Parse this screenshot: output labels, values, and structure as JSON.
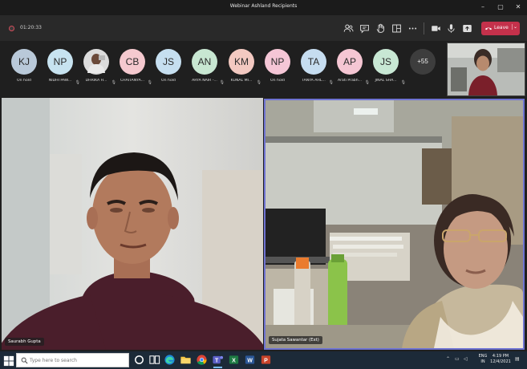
{
  "window": {
    "title": "Webinar Ashland Recipients"
  },
  "toolbar": {
    "timer": "01:20:33",
    "leave_label": "Leave",
    "accent": "#c4314b"
  },
  "participants": [
    {
      "initials": "KJ",
      "name": "On hold",
      "color": "#b9c9d9",
      "muted": false
    },
    {
      "initials": "NP",
      "name": "NIDHI PAW...",
      "color": "#c7e3f0",
      "muted": true
    },
    {
      "initials": "",
      "name": "DHRIKA H...",
      "color": "#e6e6e6",
      "muted": true,
      "photo": true
    },
    {
      "initials": "CB",
      "name": "CHAITANYA...",
      "color": "#f5c9cf",
      "muted": true
    },
    {
      "initials": "JS",
      "name": "On hold",
      "color": "#c6dff0",
      "muted": false
    },
    {
      "initials": "AN",
      "name": "ARYA NAIR -...",
      "color": "#c8e7d2",
      "muted": true
    },
    {
      "initials": "KM",
      "name": "KUNAL MI...",
      "color": "#f3c9c1",
      "muted": true
    },
    {
      "initials": "NP",
      "name": "On hold",
      "color": "#f5c6d6",
      "muted": false
    },
    {
      "initials": "TA",
      "name": "TANYA AHL...",
      "color": "#c6ddf0",
      "muted": true
    },
    {
      "initials": "AP",
      "name": "Arati Prabh...",
      "color": "#f5c6d3",
      "muted": true
    },
    {
      "initials": "JS",
      "name": "JINAL SHA...",
      "color": "#c8e8d4",
      "muted": true
    }
  ],
  "more_count": "+55",
  "videos": {
    "left_name": "Saurabh Gupta",
    "right_name": "Sujata Sawantar (Ext)"
  },
  "taskbar": {
    "search_placeholder": "Type here to search",
    "lang_top": "ENG",
    "lang_bottom": "IN",
    "time": "4:19 PM",
    "date": "12/4/2021"
  }
}
